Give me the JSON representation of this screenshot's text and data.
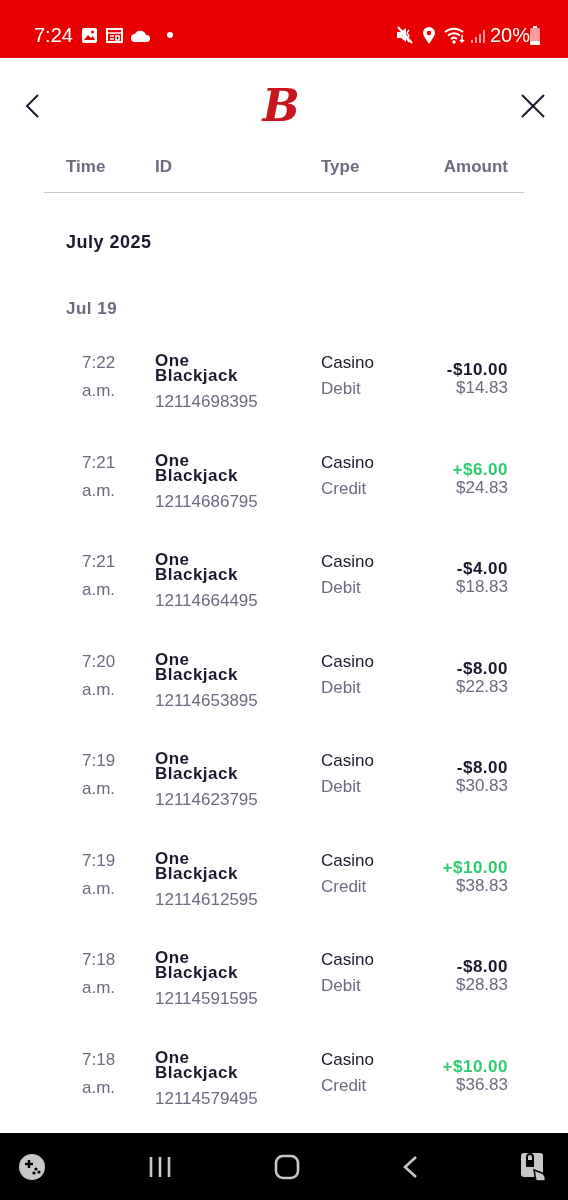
{
  "status_bar": {
    "time": "7:24",
    "battery": "20%"
  },
  "header": {
    "logo": "B"
  },
  "columns": [
    "Time",
    "ID",
    "Type",
    "Amount"
  ],
  "month": "July 2025",
  "day": "Jul 19",
  "transactions": [
    {
      "time": "7:22",
      "period": "a.m.",
      "game": "One Blackjack",
      "id": "12114698395",
      "category": "Casino",
      "type": "Debit",
      "kind": "debit",
      "amount": "-$10.00",
      "balance": "$14.83"
    },
    {
      "time": "7:21",
      "period": "a.m.",
      "game": "One Blackjack",
      "id": "12114686795",
      "category": "Casino",
      "type": "Credit",
      "kind": "credit",
      "amount": "+$6.00",
      "balance": "$24.83"
    },
    {
      "time": "7:21",
      "period": "a.m.",
      "game": "One Blackjack",
      "id": "12114664495",
      "category": "Casino",
      "type": "Debit",
      "kind": "debit",
      "amount": "-$4.00",
      "balance": "$18.83"
    },
    {
      "time": "7:20",
      "period": "a.m.",
      "game": "One Blackjack",
      "id": "12114653895",
      "category": "Casino",
      "type": "Debit",
      "kind": "debit",
      "amount": "-$8.00",
      "balance": "$22.83"
    },
    {
      "time": "7:19",
      "period": "a.m.",
      "game": "One Blackjack",
      "id": "12114623795",
      "category": "Casino",
      "type": "Debit",
      "kind": "debit",
      "amount": "-$8.00",
      "balance": "$30.83"
    },
    {
      "time": "7:19",
      "period": "a.m.",
      "game": "One Blackjack",
      "id": "12114612595",
      "category": "Casino",
      "type": "Credit",
      "kind": "credit",
      "amount": "+$10.00",
      "balance": "$38.83"
    },
    {
      "time": "7:18",
      "period": "a.m.",
      "game": "One Blackjack",
      "id": "12114591595",
      "category": "Casino",
      "type": "Debit",
      "kind": "debit",
      "amount": "-$8.00",
      "balance": "$28.83"
    },
    {
      "time": "7:18",
      "period": "a.m.",
      "game": "One Blackjack",
      "id": "12114579495",
      "category": "Casino",
      "type": "Credit",
      "kind": "credit",
      "amount": "+$10.00",
      "balance": "$36.83"
    }
  ]
}
